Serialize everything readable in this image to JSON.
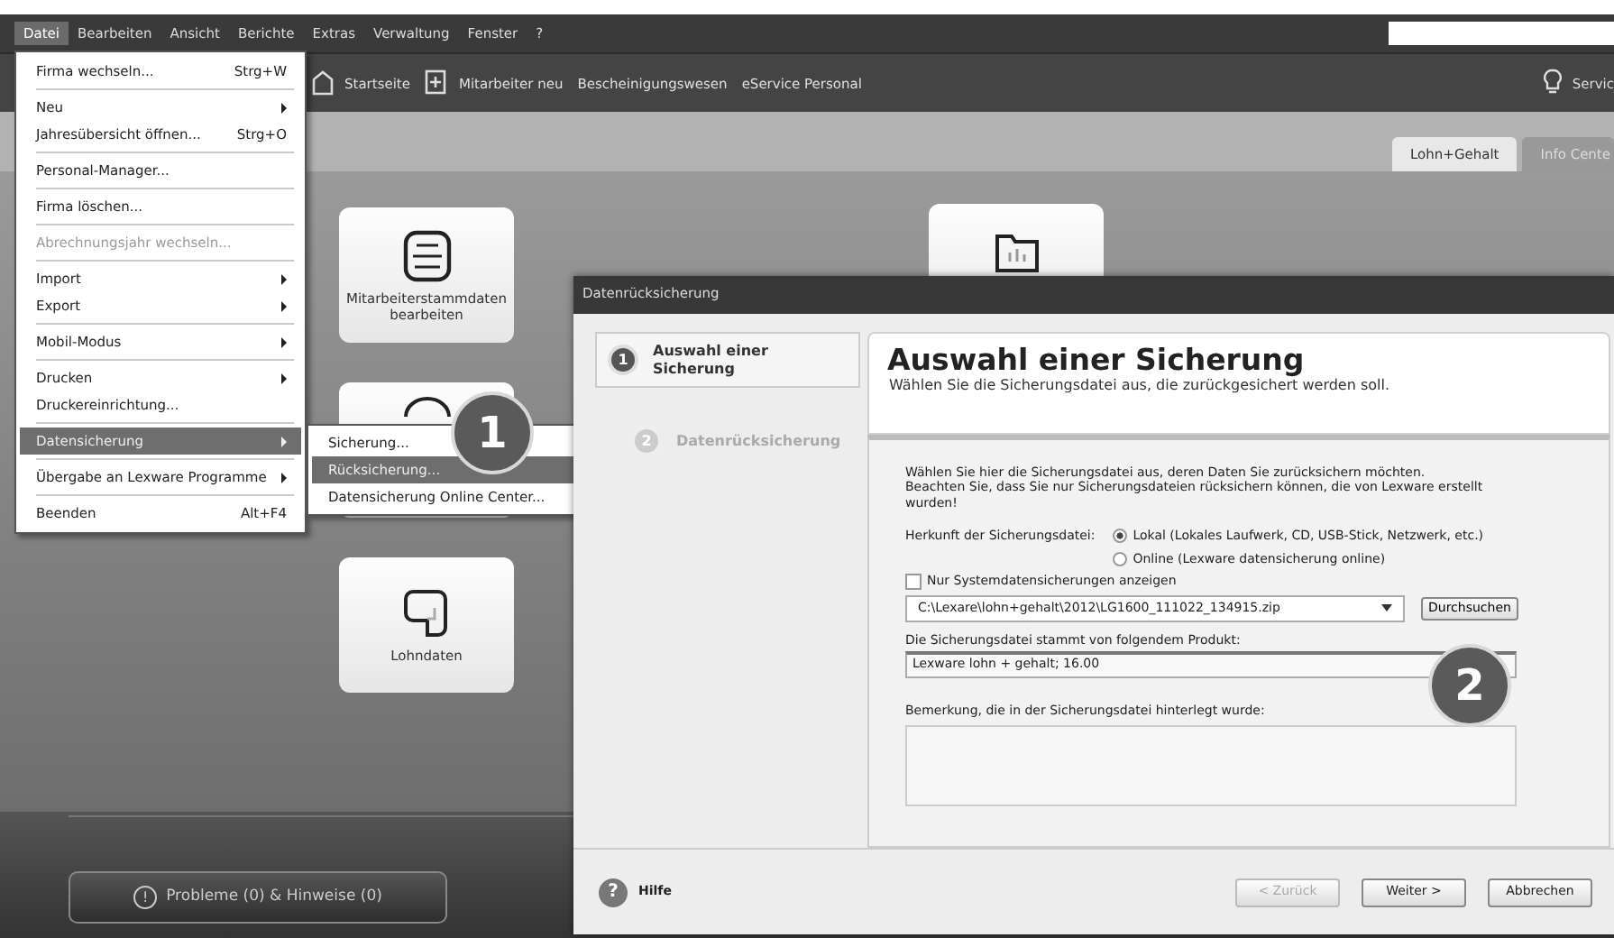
{
  "menu_bar": {
    "items": [
      {
        "label": "Datei",
        "selected": true
      },
      {
        "label": "Bearbeiten",
        "selected": false
      },
      {
        "label": "Ansicht",
        "selected": false
      },
      {
        "label": "Berichte",
        "selected": false
      },
      {
        "label": "Extras",
        "selected": false
      },
      {
        "label": "Verwaltung",
        "selected": false
      },
      {
        "label": "Fenster",
        "selected": false
      },
      {
        "label": "?",
        "selected": false
      }
    ]
  },
  "toolbar": {
    "items": [
      {
        "label": "Startseite",
        "kind": "with-icon"
      },
      {
        "label": "Mitarbeiter neu",
        "kind": "with-icon"
      },
      {
        "label": "Bescheinigungswesen",
        "kind": "plain"
      },
      {
        "label": "eService Personal",
        "kind": "plain"
      }
    ],
    "service": {
      "label": "Servic"
    }
  },
  "tabs": [
    {
      "label": "Lohn+Gehalt",
      "selected": true
    },
    {
      "label": "Info Cente",
      "selected": false
    }
  ],
  "tiles": [
    {
      "label": "Mitarbeiterstammdaten bearbeiten"
    },
    {
      "label": "Lohndaten"
    }
  ],
  "status_button": {
    "icon": "!",
    "label": "Probleme (0) & Hinweise (0)"
  },
  "file_menu": {
    "items": [
      {
        "kind": "item",
        "label": "Firma wechseln...",
        "shortcut": "Strg+W",
        "submenu": false,
        "disabled": false,
        "selected": false
      },
      {
        "kind": "separator"
      },
      {
        "kind": "item",
        "label": "Neu",
        "submenu": true,
        "disabled": false,
        "selected": false
      },
      {
        "kind": "item",
        "label": "Jahresübersicht öffnen...",
        "shortcut": "Strg+O",
        "submenu": false,
        "disabled": false,
        "selected": false
      },
      {
        "kind": "separator"
      },
      {
        "kind": "item",
        "label": "Personal-Manager...",
        "submenu": false,
        "disabled": false,
        "selected": false
      },
      {
        "kind": "separator"
      },
      {
        "kind": "item",
        "label": "Firma löschen...",
        "submenu": false,
        "disabled": false,
        "selected": false
      },
      {
        "kind": "separator"
      },
      {
        "kind": "item",
        "label": "Abrechnungsjahr wechseln...",
        "submenu": false,
        "disabled": true,
        "selected": false
      },
      {
        "kind": "separator"
      },
      {
        "kind": "item",
        "label": "Import",
        "submenu": true,
        "disabled": false,
        "selected": false
      },
      {
        "kind": "item",
        "label": "Export",
        "submenu": true,
        "disabled": false,
        "selected": false
      },
      {
        "kind": "separator"
      },
      {
        "kind": "item",
        "label": "Mobil-Modus",
        "submenu": true,
        "disabled": false,
        "selected": false
      },
      {
        "kind": "separator"
      },
      {
        "kind": "item",
        "label": "Drucken",
        "submenu": true,
        "disabled": false,
        "selected": false
      },
      {
        "kind": "item",
        "label": "Druckereinrichtung...",
        "submenu": false,
        "disabled": false,
        "selected": false
      },
      {
        "kind": "separator"
      },
      {
        "kind": "item",
        "label": "Datensicherung",
        "submenu": true,
        "disabled": false,
        "selected": true
      },
      {
        "kind": "separator"
      },
      {
        "kind": "item",
        "label": "Übergabe an Lexware Programme",
        "submenu": true,
        "disabled": false,
        "selected": false
      },
      {
        "kind": "separator"
      },
      {
        "kind": "item",
        "label": "Beenden",
        "shortcut": "Alt+F4",
        "submenu": false,
        "disabled": false,
        "selected": false
      }
    ]
  },
  "submenu": {
    "items": [
      {
        "label": "Sicherung...",
        "selected": false
      },
      {
        "label": "Rücksicherung...",
        "selected": true
      },
      {
        "label": "Datensicherung Online Center...",
        "selected": false
      }
    ]
  },
  "dialog": {
    "title": "Datenrücksicherung",
    "steps": [
      {
        "number": "1",
        "label": "Auswahl einer Sicherung",
        "selected": true
      },
      {
        "number": "2",
        "label": "Datenrücksicherung",
        "selected": false
      }
    ],
    "header": {
      "title": "Auswahl einer Sicherung",
      "subtitle": "Wählen Sie die Sicherungsdatei aus, die zurückgesichert werden soll."
    },
    "intro": "Wählen Sie hier die Sicherungsdatei aus, deren Daten Sie zurücksichern möchten.\nBeachten Sie, dass Sie nur Sicherungsdateien rücksichern können, die von Lexware erstellt wurden!",
    "source": {
      "label": "Herkunft der Sicherungsdatei:",
      "options": [
        {
          "label": "Lokal (Lokales Laufwerk, CD, USB-Stick, Netzwerk, etc.)",
          "selected": true
        },
        {
          "label": "Online (Lexware datensicherung online)",
          "selected": false
        }
      ]
    },
    "system_only": {
      "label": "Nur Systemdatensicherungen anzeigen",
      "checked": false
    },
    "file": {
      "value": "C:\\Lexare\\lohn+gehalt\\2012\\LG1600_111022_134915.zip"
    },
    "browse_button": {
      "label": "Durchsuchen"
    },
    "product": {
      "label": "Die Sicherungsdatei stammt von folgendem Produkt:",
      "value": "Lexware lohn + gehalt; 16.00"
    },
    "remark": {
      "label": "Bemerkung, die in der Sicherungsdatei hinterlegt wurde:"
    },
    "help": {
      "icon": "?",
      "label": "Hilfe"
    },
    "buttons": [
      {
        "label": "< Zurück",
        "disabled": true
      },
      {
        "label": "Weiter >",
        "disabled": false
      },
      {
        "label": "Abbrechen",
        "disabled": false
      }
    ]
  },
  "callouts": [
    {
      "label": "1"
    },
    {
      "label": "2"
    }
  ]
}
